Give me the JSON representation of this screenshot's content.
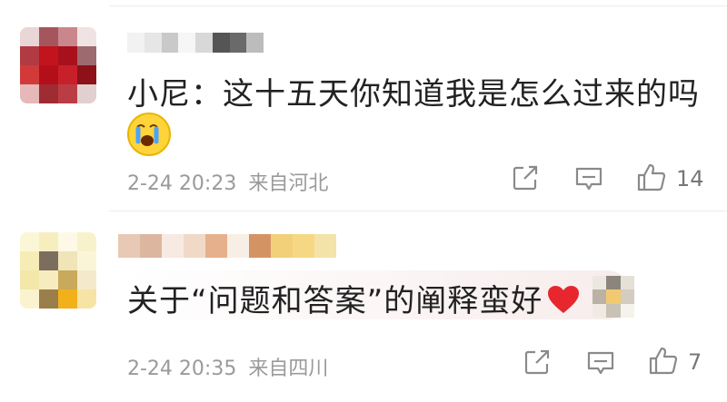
{
  "comments": [
    {
      "text": "小尼：这十五天你知道我是怎么过来的吗",
      "emoji": "crying-face",
      "time": "2-24 20:23",
      "location": "来自河北",
      "likes": "14"
    },
    {
      "text": "关于“问题和答案”的阐释蛮好",
      "emoji": "red-heart",
      "time": "2-24 20:35",
      "location": "来自四川",
      "likes": "7"
    }
  ],
  "colors": {
    "text": "#222222",
    "meta": "#9a9a9a",
    "heart": "#e8262d",
    "emoji_face": "#ffd43b",
    "tear": "#4aa3ff"
  }
}
